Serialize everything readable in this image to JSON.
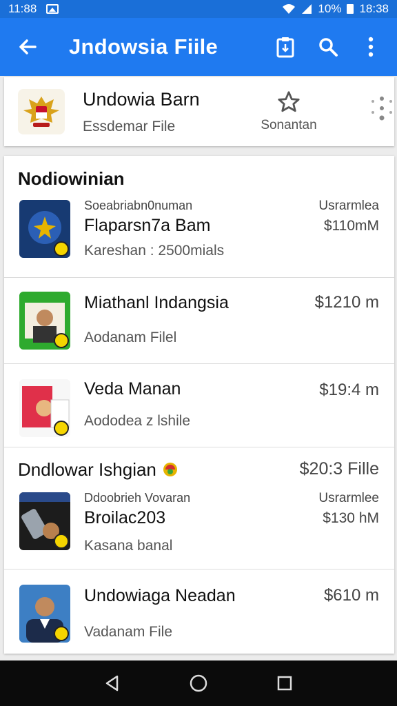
{
  "status_bar": {
    "time_left": "11:88",
    "battery": "10%",
    "time_right": "18:38"
  },
  "app_bar": {
    "title": "Jndowsia Fiile"
  },
  "top_card": {
    "title": "Undowia Barn",
    "subtitle": "Essdemar File",
    "star_label": "Sonantan"
  },
  "section_1": {
    "title": "Nodiowinian",
    "item": {
      "small": "Soeabriabn0numan",
      "title": "Flaparsn7a Bam",
      "subtitle": "Kareshan : 2500mials",
      "price_label": "Usrarmlea",
      "price": "$110mM"
    }
  },
  "items": [
    {
      "title": "Miathanl Indangsia",
      "subtitle": "Aodanam Filel",
      "price": "$1210 m"
    },
    {
      "title": "Veda Manan",
      "subtitle": "Aododea z lshile",
      "price": "$19:4 m"
    }
  ],
  "section_2": {
    "title": "Dndlowar Ishgian",
    "title_price": "$20:3 Fille",
    "item": {
      "small": "Ddoobrieh Vovaran",
      "title": "Broilac203",
      "subtitle": "Kasana banal",
      "price_label": "Usrarmlee",
      "price": "$130 hM"
    }
  },
  "last_item": {
    "title": "Undowiaga Neadan",
    "subtitle": "Vadanam File",
    "price": "$610 m"
  },
  "colors": {
    "primary": "#1f7af0",
    "status_bar": "#1a6fd8",
    "nav_bar": "#0b0b0b"
  },
  "icons": [
    "back-arrow-icon",
    "clipboard-icon",
    "search-icon",
    "more-vert-icon",
    "star-icon",
    "emblem-logo",
    "back-nav-icon",
    "home-nav-icon",
    "recents-nav-icon"
  ]
}
